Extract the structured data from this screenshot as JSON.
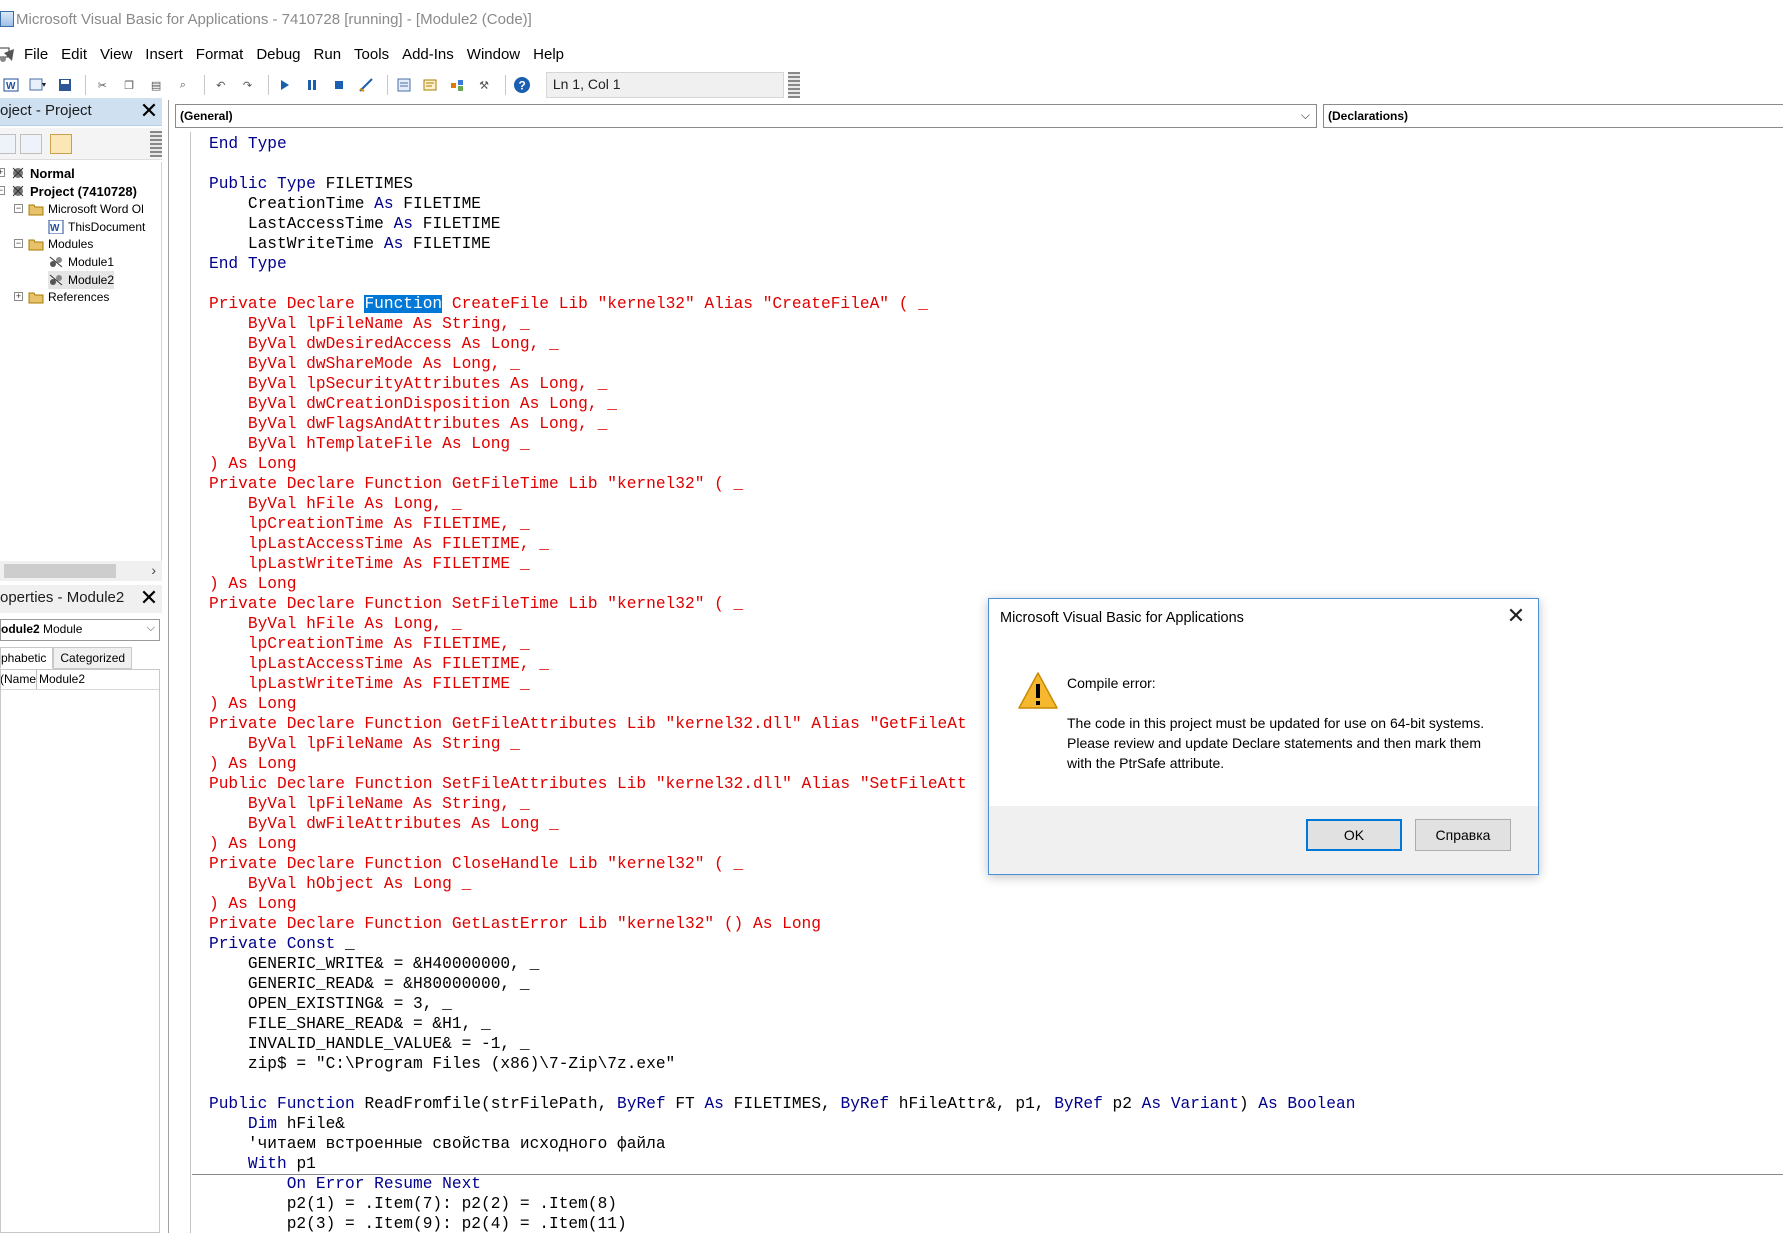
{
  "window": {
    "title": "Microsoft Visual Basic for Applications - 7410728 [running] - [Module2 (Code)]"
  },
  "menu": [
    "File",
    "Edit",
    "View",
    "Insert",
    "Format",
    "Debug",
    "Run",
    "Tools",
    "Add-Ins",
    "Window",
    "Help"
  ],
  "toolbar": {
    "position": "Ln 1, Col 1"
  },
  "project_pane": {
    "title": "oject - Project",
    "tree": {
      "normal": "Normal",
      "project": "Project (7410728)",
      "word_objects": "Microsoft Word Ol",
      "this_document": "ThisDocument",
      "modules": "Modules",
      "module1": "Module1",
      "module2": "Module2",
      "references": "References"
    }
  },
  "properties_pane": {
    "title": "operties - Module2",
    "object_name": "odule2",
    "object_type": "Module",
    "tabs": [
      "phabetic",
      "Categorized"
    ],
    "row_key": "Name)",
    "row_value": "Module2"
  },
  "code_window": {
    "object_combo": "(General)",
    "procedure_combo": "(Declarations)",
    "lines": [
      [
        [
          "kw",
          "End Type"
        ]
      ],
      [],
      [
        [
          "kw",
          "Public Type "
        ],
        [
          "blk",
          "FILETIMES"
        ]
      ],
      [
        [
          "blk",
          "    CreationTime "
        ],
        [
          "kw",
          "As "
        ],
        [
          "blk",
          "FILETIME"
        ]
      ],
      [
        [
          "blk",
          "    LastAccessTime "
        ],
        [
          "kw",
          "As "
        ],
        [
          "blk",
          "FILETIME"
        ]
      ],
      [
        [
          "blk",
          "    LastWriteTime "
        ],
        [
          "kw",
          "As "
        ],
        [
          "blk",
          "FILETIME"
        ]
      ],
      [
        [
          "kw",
          "End Type"
        ]
      ],
      [],
      [
        [
          "err",
          "Private Declare "
        ],
        [
          "sel",
          "Function"
        ],
        [
          "err",
          " CreateFile Lib \"kernel32\" Alias \"CreateFileA\" ( _"
        ]
      ],
      [
        [
          "err",
          "    ByVal lpFileName As String, _"
        ]
      ],
      [
        [
          "err",
          "    ByVal dwDesiredAccess As Long, _"
        ]
      ],
      [
        [
          "err",
          "    ByVal dwShareMode As Long, _"
        ]
      ],
      [
        [
          "err",
          "    ByVal lpSecurityAttributes As Long, _"
        ]
      ],
      [
        [
          "err",
          "    ByVal dwCreationDisposition As Long, _"
        ]
      ],
      [
        [
          "err",
          "    ByVal dwFlagsAndAttributes As Long, _"
        ]
      ],
      [
        [
          "err",
          "    ByVal hTemplateFile As Long _"
        ]
      ],
      [
        [
          "err",
          ") As Long"
        ]
      ],
      [
        [
          "err",
          "Private Declare Function GetFileTime Lib \"kernel32\" ( _"
        ]
      ],
      [
        [
          "err",
          "    ByVal hFile As Long, _"
        ]
      ],
      [
        [
          "err",
          "    lpCreationTime As FILETIME, _"
        ]
      ],
      [
        [
          "err",
          "    lpLastAccessTime As FILETIME, _"
        ]
      ],
      [
        [
          "err",
          "    lpLastWriteTime As FILETIME _"
        ]
      ],
      [
        [
          "err",
          ") As Long"
        ]
      ],
      [
        [
          "err",
          "Private Declare Function SetFileTime Lib \"kernel32\" ( _"
        ]
      ],
      [
        [
          "err",
          "    ByVal hFile As Long, _"
        ]
      ],
      [
        [
          "err",
          "    lpCreationTime As FILETIME, _"
        ]
      ],
      [
        [
          "err",
          "    lpLastAccessTime As FILETIME, _"
        ]
      ],
      [
        [
          "err",
          "    lpLastWriteTime As FILETIME _"
        ]
      ],
      [
        [
          "err",
          ") As Long"
        ]
      ],
      [
        [
          "err",
          "Private Declare Function GetFileAttributes Lib \"kernel32.dll\" Alias \"GetFileAt"
        ]
      ],
      [
        [
          "err",
          "    ByVal lpFileName As String _"
        ]
      ],
      [
        [
          "err",
          ") As Long"
        ]
      ],
      [
        [
          "err",
          "Public Declare Function SetFileAttributes Lib \"kernel32.dll\" Alias \"SetFileAtt"
        ]
      ],
      [
        [
          "err",
          "    ByVal lpFileName As String, _"
        ]
      ],
      [
        [
          "err",
          "    ByVal dwFileAttributes As Long _"
        ]
      ],
      [
        [
          "err",
          ") As Long"
        ]
      ],
      [
        [
          "err",
          "Private Declare Function CloseHandle Lib \"kernel32\" ( _"
        ]
      ],
      [
        [
          "err",
          "    ByVal hObject As Long _"
        ]
      ],
      [
        [
          "err",
          ") As Long"
        ]
      ],
      [
        [
          "err",
          "Private Declare Function GetLastError Lib \"kernel32\" () As Long"
        ]
      ],
      [
        [
          "kw",
          "Private Const "
        ],
        [
          "blk",
          "_"
        ]
      ],
      [
        [
          "blk",
          "    GENERIC_WRITE& = &H40000000, _"
        ]
      ],
      [
        [
          "blk",
          "    GENERIC_READ& = &H80000000, _"
        ]
      ],
      [
        [
          "blk",
          "    OPEN_EXISTING& = 3, _"
        ]
      ],
      [
        [
          "blk",
          "    FILE_SHARE_READ& = &H1, _"
        ]
      ],
      [
        [
          "blk",
          "    INVALID_HANDLE_VALUE& = -1, _"
        ]
      ],
      [
        [
          "blk",
          "    zip$ = \"C:\\Program Files (x86)\\7-Zip\\7z.exe\""
        ]
      ],
      [],
      [
        [
          "kw",
          "Public Function "
        ],
        [
          "blk",
          "ReadFromfile(strFilePath, "
        ],
        [
          "kw",
          "ByRef "
        ],
        [
          "blk",
          "FT "
        ],
        [
          "kw",
          "As "
        ],
        [
          "blk",
          "FILETIMES, "
        ],
        [
          "kw",
          "ByRef "
        ],
        [
          "blk",
          "hFileAttr&, p1, "
        ],
        [
          "kw",
          "ByRef "
        ],
        [
          "blk",
          "p2 "
        ],
        [
          "kw",
          "As Variant"
        ],
        [
          "blk",
          ") "
        ],
        [
          "kw",
          "As Boolean"
        ]
      ],
      [
        [
          "kw",
          "    Dim "
        ],
        [
          "blk",
          "hFile&"
        ]
      ],
      [
        [
          "blk",
          "    'читаем встроенные свойства исходного файла"
        ]
      ],
      [
        [
          "kw",
          "    With "
        ],
        [
          "blk",
          "p1"
        ]
      ],
      [
        [
          "kw",
          "        On Error Resume Next"
        ]
      ],
      [
        [
          "blk",
          "        p2(1) = .Item(7): p2(2) = .Item(8)"
        ]
      ],
      [
        [
          "blk",
          "        p2(3) = .Item(9): p2(4) = .Item(11)"
        ]
      ]
    ]
  },
  "dialog": {
    "title": "Microsoft Visual Basic for Applications",
    "heading": "Compile error:",
    "message": "The code in this project must be updated for use on 64-bit systems.  Please review and update Declare statements and then mark them with the PtrSafe attribute.",
    "ok_label": "OK",
    "help_label": "Справка"
  },
  "colors": {
    "keyword": "#00008b",
    "error_text": "#e00000",
    "selection": "#0078d7",
    "dialog_border": "#4a90d9"
  }
}
